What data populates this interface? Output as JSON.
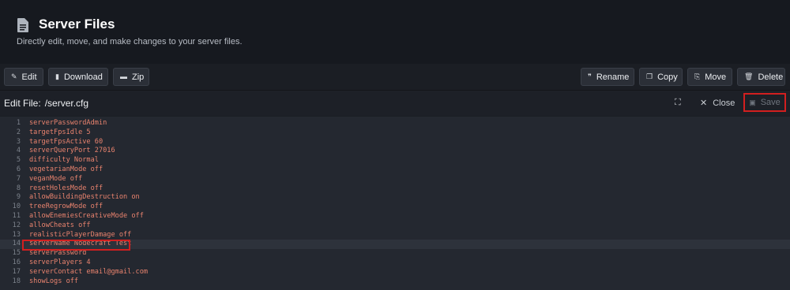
{
  "header": {
    "title": "Server Files",
    "subtitle": "Directly edit, move, and make changes to your server files.",
    "icon": "document-icon"
  },
  "toolbar": {
    "edit": "Edit",
    "download": "Download",
    "zip": "Zip",
    "rename": "Rename",
    "copy": "Copy",
    "move": "Move",
    "delete": "Delete"
  },
  "editor_header": {
    "label": "Edit File:",
    "path": "/server.cfg",
    "close": "Close",
    "save": "Save"
  },
  "editor": {
    "active_line": 14,
    "lines": [
      {
        "n": "1",
        "text": "serverPasswordAdmin"
      },
      {
        "n": "2",
        "text": "targetFpsIdle 5"
      },
      {
        "n": "3",
        "text": "targetFpsActive 60"
      },
      {
        "n": "4",
        "text": "serverQueryPort 27016"
      },
      {
        "n": "5",
        "text": "difficulty Normal"
      },
      {
        "n": "6",
        "text": "vegetarianMode off"
      },
      {
        "n": "7",
        "text": "veganMode off"
      },
      {
        "n": "8",
        "text": "resetHolesMode off"
      },
      {
        "n": "9",
        "text": "allowBuildingDestruction on"
      },
      {
        "n": "10",
        "text": "treeRegrowMode off"
      },
      {
        "n": "11",
        "text": "allowEnemiesCreativeMode off"
      },
      {
        "n": "12",
        "text": "allowCheats off"
      },
      {
        "n": "13",
        "text": "realisticPlayerDamage off"
      },
      {
        "n": "14",
        "text": "serverName Nodecraft Test"
      },
      {
        "n": "15",
        "text": "serverPassword"
      },
      {
        "n": "16",
        "text": "serverPlayers 4"
      },
      {
        "n": "17",
        "text": "serverContact email@gmail.com"
      },
      {
        "n": "18",
        "text": "showLogs off"
      }
    ]
  },
  "colors": {
    "accent_red": "#d21f1f",
    "code_text": "#e9836e"
  }
}
